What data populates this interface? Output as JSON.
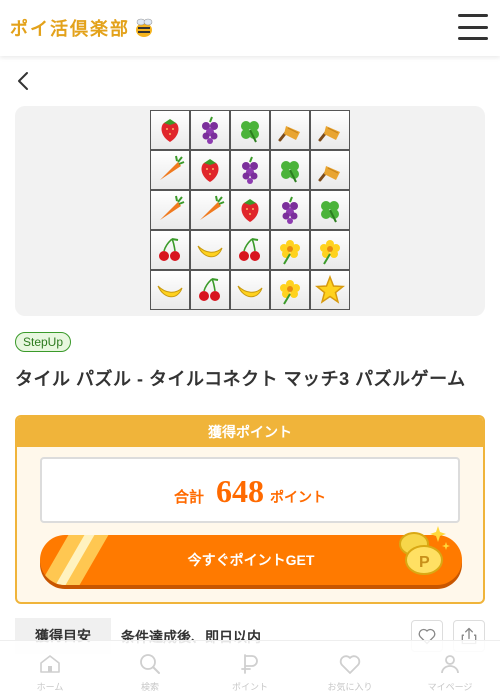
{
  "header": {
    "logo_text": "ポイ活倶楽部",
    "logo_icon": "bee-icon",
    "menu_icon": "hamburger-icon"
  },
  "back_icon": "chevron-left-icon",
  "game": {
    "badge": "StepUp",
    "title": "タイル パズル - タイルコネクト マッチ3 パズルゲーム",
    "tiles": [
      [
        "strawberry",
        "grape",
        "clover",
        "broom",
        "broom"
      ],
      [
        "carrot",
        "strawberry",
        "grape",
        "clover",
        "broom"
      ],
      [
        "carrot",
        "carrot",
        "strawberry",
        "grape",
        "clover"
      ],
      [
        "cherry",
        "banana",
        "cherry",
        "flower",
        "flower"
      ],
      [
        "banana",
        "cherry",
        "banana",
        "flower",
        "star"
      ]
    ]
  },
  "points": {
    "header": "獲得ポイント",
    "total_label": "合計",
    "total_value": "648",
    "total_unit": "ポイント",
    "cta_label": "今すぐポイントGET"
  },
  "target": {
    "label": "獲得目安",
    "text": "条件達成後、即日以内"
  },
  "actions": {
    "favorite_icon": "heart-icon",
    "share_icon": "share-icon"
  },
  "nav": [
    {
      "label": "ホーム",
      "icon": "home-icon"
    },
    {
      "label": "検索",
      "icon": "search-icon"
    },
    {
      "label": "ポイント",
      "icon": "point-icon"
    },
    {
      "label": "お気に入り",
      "icon": "heart-icon"
    },
    {
      "label": "マイページ",
      "icon": "user-icon"
    }
  ],
  "colors": {
    "brand": "#e3a21b",
    "accent": "#ff7a00",
    "points_border": "#f0b43a",
    "badge_green": "#3a9a2a"
  }
}
